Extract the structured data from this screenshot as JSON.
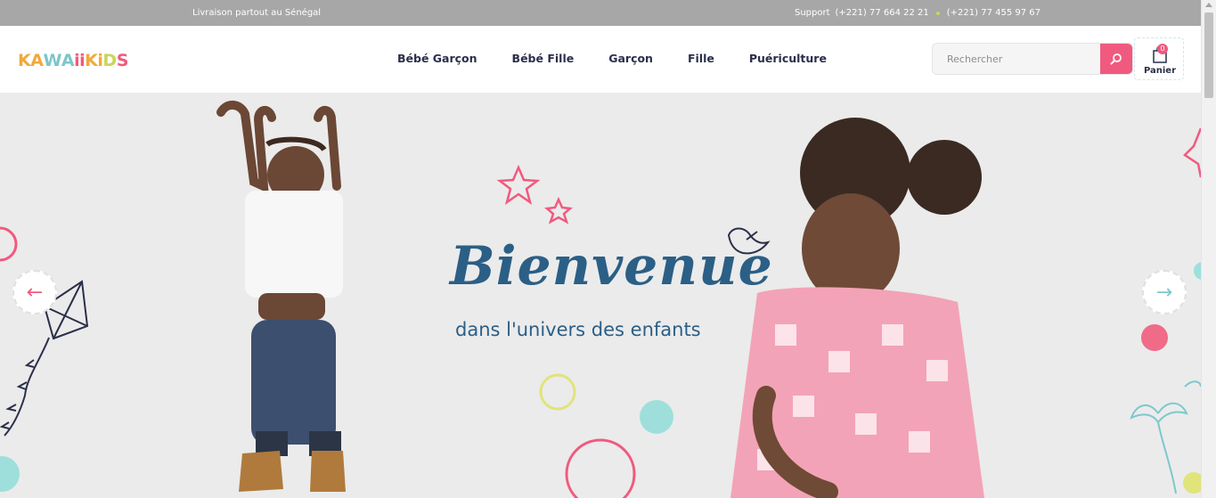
{
  "topbar": {
    "shipping": "Livraison partout au Sénégal",
    "support_label": "Support",
    "phone_1": "(+221) 77 664 22 21",
    "phone_2": "(+221) 77 455 97 67"
  },
  "brand": {
    "letters": [
      "K",
      "A",
      "W",
      "A",
      "ii",
      "K",
      "i",
      "D",
      "S"
    ],
    "colors": [
      "#f0a93b",
      "#f0a93b",
      "#7cc6c9",
      "#7cc6c9",
      "#f05a7e",
      "#f0a93b",
      "#f0a93b",
      "#c9d65a",
      "#f05a7e"
    ]
  },
  "nav": {
    "items": [
      "Bébé Garçon",
      "Bébé Fille",
      "Garçon",
      "Fille",
      "Puériculture"
    ]
  },
  "search": {
    "placeholder": "Rechercher",
    "icon": "search-icon"
  },
  "cart": {
    "label": "Panier",
    "count": "0",
    "icon": "shopping-bag-icon"
  },
  "hero": {
    "title": "Bienvenue",
    "subtitle": "dans l'univers des enfants"
  },
  "colors": {
    "accent": "#f05a7e",
    "brand_text": "#2b5f86",
    "nav_text": "#2b2f4a",
    "topbar_bg": "#a7a7a7",
    "hero_bg": "#ebebeb"
  }
}
